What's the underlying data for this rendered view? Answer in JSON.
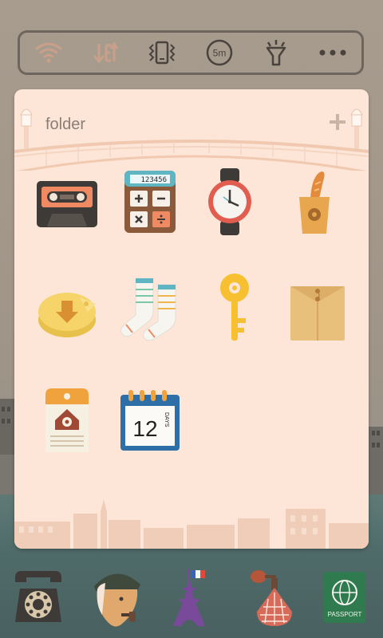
{
  "status_toggles": [
    {
      "icon": "wifi-icon"
    },
    {
      "icon": "data-transfer-icon"
    },
    {
      "icon": "vibrate-icon"
    },
    {
      "icon": "screen-timeout-icon",
      "label": "5m"
    },
    {
      "icon": "flashlight-icon"
    },
    {
      "icon": "more-icon"
    }
  ],
  "folder": {
    "title": "folder",
    "apps": [
      {
        "name": "cassette-app",
        "icon": "cassette-icon"
      },
      {
        "name": "calculator-app",
        "icon": "calculator-icon",
        "display": "123456"
      },
      {
        "name": "clock-app",
        "icon": "watch-icon"
      },
      {
        "name": "shopping-app",
        "icon": "baguette-bag-icon"
      },
      {
        "name": "download-app",
        "icon": "cheese-download-icon"
      },
      {
        "name": "socks-app",
        "icon": "socks-icon"
      },
      {
        "name": "key-app",
        "icon": "key-icon"
      },
      {
        "name": "envelope-app",
        "icon": "envelope-icon"
      },
      {
        "name": "home-settings-app",
        "icon": "house-tag-icon"
      },
      {
        "name": "calendar-app",
        "icon": "calendar-icon",
        "day": "12",
        "label": "DAYS"
      }
    ]
  },
  "dock": [
    {
      "icon": "rotary-phone-icon"
    },
    {
      "icon": "avatar-pipe-icon"
    },
    {
      "icon": "eiffel-tower-icon"
    },
    {
      "icon": "perfume-icon"
    },
    {
      "icon": "passport-icon",
      "label": "PASSPORT"
    }
  ],
  "colors": {
    "panel": "#fde6d7",
    "toggle_inactive": "#c9a08a",
    "toggle_active": "#4a423c"
  }
}
